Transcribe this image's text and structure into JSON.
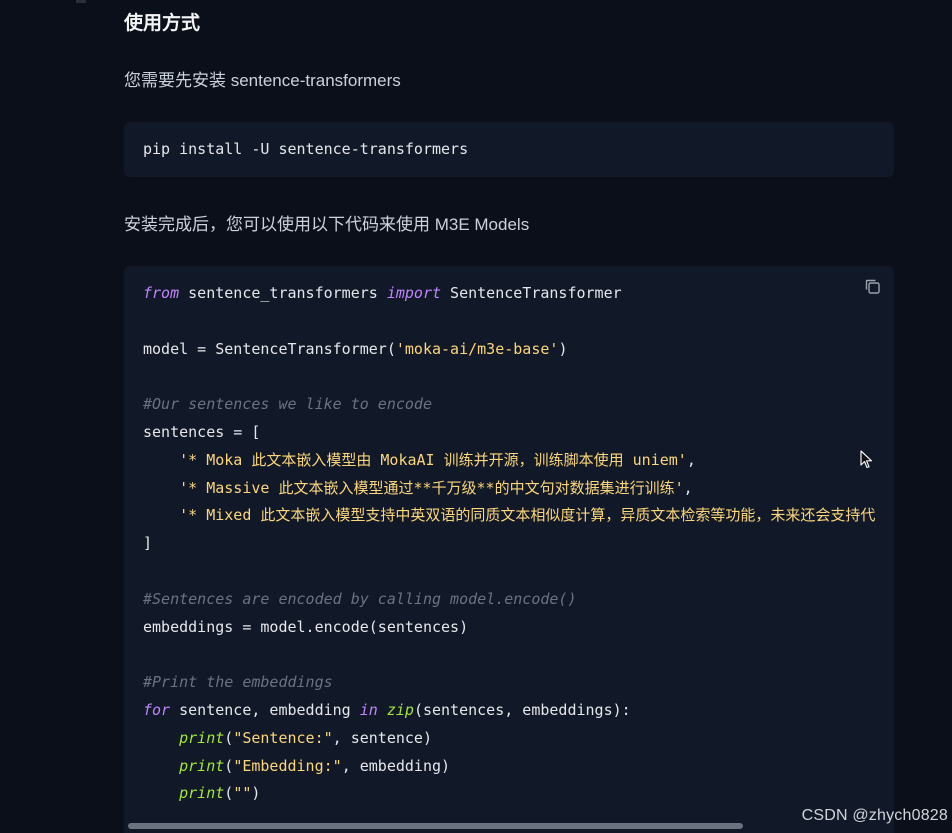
{
  "section": {
    "heading": "使用方式",
    "install_intro": "您需要先安装 sentence-transformers",
    "install_command": "pip install -U sentence-transformers",
    "usage_intro": "安装完成后，您可以使用以下代码来使用 M3E Models"
  },
  "code": {
    "lines": [
      [
        {
          "t": "from",
          "c": "kw"
        },
        {
          "t": " sentence_transformers ",
          "c": ""
        },
        {
          "t": "import",
          "c": "kw"
        },
        {
          "t": " SentenceTransformer",
          "c": ""
        }
      ],
      [],
      [
        {
          "t": "model = SentenceTransformer(",
          "c": ""
        },
        {
          "t": "'moka-ai/m3e-base'",
          "c": "str"
        },
        {
          "t": ")",
          "c": ""
        }
      ],
      [],
      [
        {
          "t": "#Our sentences we like to encode",
          "c": "cmt"
        }
      ],
      [
        {
          "t": "sentences = [",
          "c": ""
        }
      ],
      [
        {
          "t": "    ",
          "c": ""
        },
        {
          "t": "'* Moka 此文本嵌入模型由 MokaAI 训练并开源，训练脚本使用 uniem'",
          "c": "str"
        },
        {
          "t": ",",
          "c": ""
        }
      ],
      [
        {
          "t": "    ",
          "c": ""
        },
        {
          "t": "'* Massive 此文本嵌入模型通过**千万级**的中文句对数据集进行训练'",
          "c": "str"
        },
        {
          "t": ",",
          "c": ""
        }
      ],
      [
        {
          "t": "    ",
          "c": ""
        },
        {
          "t": "'* Mixed 此文本嵌入模型支持中英双语的同质文本相似度计算，异质文本检索等功能，未来还会支持代",
          "c": "str"
        }
      ],
      [
        {
          "t": "]",
          "c": ""
        }
      ],
      [],
      [
        {
          "t": "#Sentences are encoded by calling model.encode()",
          "c": "cmt"
        }
      ],
      [
        {
          "t": "embeddings = model.encode(sentences)",
          "c": ""
        }
      ],
      [],
      [
        {
          "t": "#Print the embeddings",
          "c": "cmt"
        }
      ],
      [
        {
          "t": "for",
          "c": "kw"
        },
        {
          "t": " sentence, embedding ",
          "c": ""
        },
        {
          "t": "in",
          "c": "kw"
        },
        {
          "t": " ",
          "c": ""
        },
        {
          "t": "zip",
          "c": "fn"
        },
        {
          "t": "(sentences, embeddings):",
          "c": ""
        }
      ],
      [
        {
          "t": "    ",
          "c": ""
        },
        {
          "t": "print",
          "c": "fn"
        },
        {
          "t": "(",
          "c": ""
        },
        {
          "t": "\"Sentence:\"",
          "c": "str"
        },
        {
          "t": ", sentence)",
          "c": ""
        }
      ],
      [
        {
          "t": "    ",
          "c": ""
        },
        {
          "t": "print",
          "c": "fn"
        },
        {
          "t": "(",
          "c": ""
        },
        {
          "t": "\"Embedding:\"",
          "c": "str"
        },
        {
          "t": ", embedding)",
          "c": ""
        }
      ],
      [
        {
          "t": "    ",
          "c": ""
        },
        {
          "t": "print",
          "c": "fn"
        },
        {
          "t": "(",
          "c": ""
        },
        {
          "t": "\"\"",
          "c": "str"
        },
        {
          "t": ")",
          "c": ""
        }
      ]
    ],
    "copy_icon": "copy-icon"
  },
  "watermark": "CSDN @zhych0828",
  "colors": {
    "background": "#0b0f19",
    "code_background": "#111827",
    "keyword": "#c084fc",
    "function": "#a3e635",
    "string": "#fcd67b",
    "comment": "#6b7280"
  }
}
